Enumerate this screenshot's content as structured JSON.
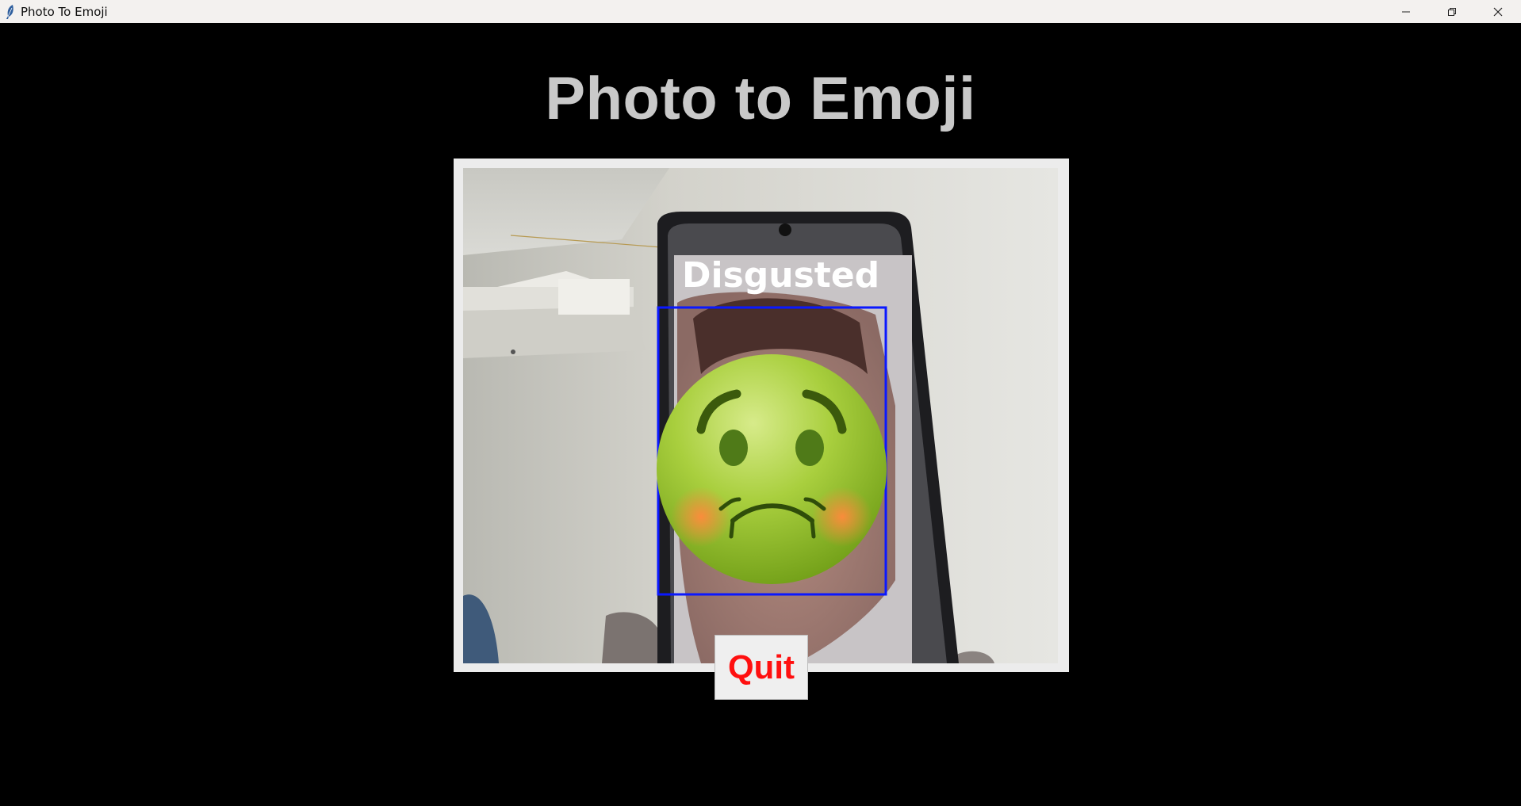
{
  "window": {
    "title": "Photo To Emoji",
    "controls": [
      "minimize-icon",
      "restore-icon",
      "close-icon"
    ]
  },
  "app": {
    "heading": "Photo to Emoji",
    "detection": {
      "label": "Disgusted",
      "box_color": "#0a18ff",
      "emoji": "nauseated-face-icon"
    },
    "quit_label": "Quit"
  },
  "colors": {
    "background": "#000000",
    "heading": "#c9c9c9",
    "quit_text": "#ff1010",
    "frame": "#ececec"
  }
}
